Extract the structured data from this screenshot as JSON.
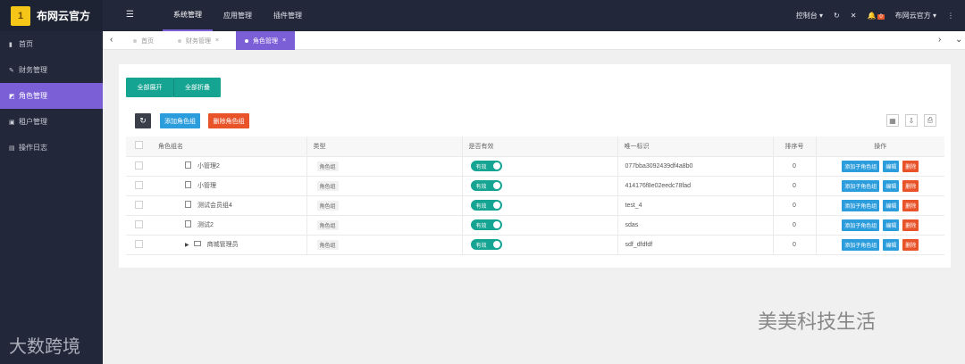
{
  "app": {
    "name": "布网云官方",
    "logo_text": "1"
  },
  "sidebar": {
    "items": [
      {
        "icon": "chart-icon",
        "glyph": "▮",
        "label": "首页"
      },
      {
        "icon": "edit-icon",
        "glyph": "✎",
        "label": "财务管理"
      },
      {
        "icon": "role-icon",
        "glyph": "◩",
        "label": "角色管理"
      },
      {
        "icon": "lock-icon",
        "glyph": "▣",
        "label": "租户管理"
      },
      {
        "icon": "log-icon",
        "glyph": "▤",
        "label": "操作日志"
      }
    ]
  },
  "topbar": {
    "menu_glyph": "☰",
    "nav": [
      "系统管理",
      "应用管理",
      "插件管理"
    ],
    "console": "控制台 ▾",
    "refresh": "↻",
    "fullscreen": "✕",
    "bell": "🔔",
    "badge": "0",
    "user": "布网云官方 ▾",
    "more": "⋮"
  },
  "tabs": {
    "left_arrow": "‹",
    "right_arrow": "›",
    "items": [
      {
        "label": "首页",
        "close": ""
      },
      {
        "label": "财务管理",
        "close": "×"
      },
      {
        "label": "角色管理",
        "close": "×"
      }
    ],
    "collapse": "⌄"
  },
  "toolbar": {
    "expand_all": "全部展开",
    "collapse_all": "全部折叠",
    "refresh": "↻",
    "add_role_group": "添加角色组",
    "delete_role_group": "删除角色组",
    "tool_columns": "▦",
    "tool_export": "⇩",
    "tool_print": "⎙"
  },
  "table": {
    "headers": [
      "角色组名",
      "类型",
      "是否有效",
      "唯一标识",
      "排序号",
      "操作"
    ],
    "rows": [
      {
        "name": "小管理2",
        "type": "角色组",
        "valid": "有效",
        "key": "077bba3092439df4a8b0",
        "order": "0"
      },
      {
        "name": "小管理",
        "type": "角色组",
        "valid": "有效",
        "key": "414176f8e02eedc78fad",
        "order": "0"
      },
      {
        "name": "测试会员组4",
        "type": "角色组",
        "valid": "有效",
        "key": "test_4",
        "order": "0"
      },
      {
        "name": "测试2",
        "type": "角色组",
        "valid": "有效",
        "key": "sdas",
        "order": "0"
      },
      {
        "name": "商城管理员",
        "type": "角色组",
        "valid": "有效",
        "key": "sdf_dfdfdf",
        "order": "0",
        "expand": "▶"
      }
    ],
    "actions": {
      "add_child": "添加子角色组",
      "edit": "编辑",
      "delete": "删除"
    }
  },
  "watermarks": {
    "right": "美美科技生活",
    "left": "大数跨境"
  },
  "colors": {
    "sidebar": "#22283a",
    "accent": "#7b5fd6",
    "teal": "#15a392",
    "blue": "#2b9cdc",
    "orange": "#e8532a"
  }
}
